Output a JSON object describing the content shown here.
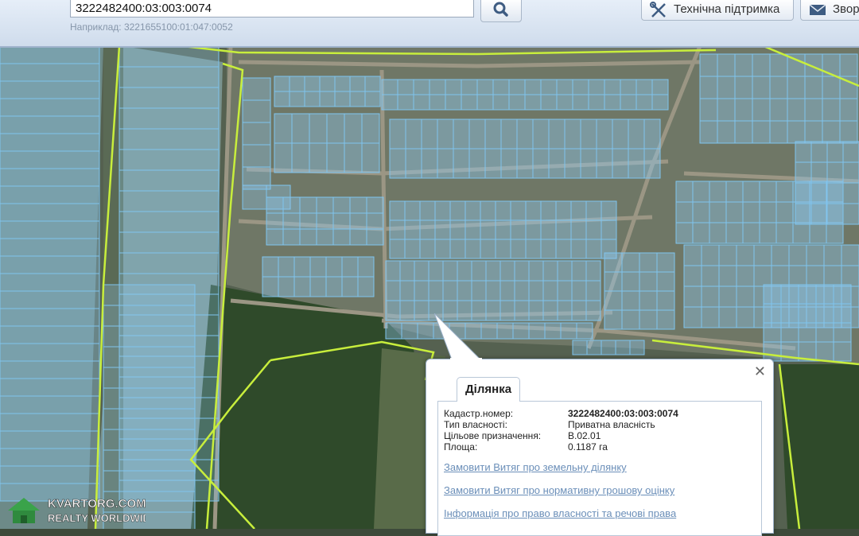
{
  "search": {
    "value": "3222482400:03:003:0074",
    "hint": "Наприклад: 3221655100:01:047:0052"
  },
  "toolbar": {
    "support_label": "Технічна підтримка",
    "feedback_label": "Звор"
  },
  "popup": {
    "tab_label": "Ділянка",
    "fields": [
      {
        "label": "Кадастр.номер:",
        "value": "3222482400:03:003:0074"
      },
      {
        "label": "Тип власності:",
        "value": "Приватна власність"
      },
      {
        "label": "Цільове призначення:",
        "value": "В.02.01"
      },
      {
        "label": "Площа:",
        "value": "0.1187 га"
      }
    ],
    "links": [
      "Замовити Витяг про земельну ділянку",
      "Замовити Витяг про нормативну грошову оцінку",
      "Інформація про право власності та речові права"
    ]
  },
  "watermark": {
    "brand": "KVARTORG.COM",
    "tagline": "REALTY WORLDWIDE"
  },
  "colors": {
    "parcel_outline": "#7fc4ee",
    "parcel_fill": "#8ec9ee",
    "boundary": "#c8ee3c",
    "link": "#6b8fb9"
  }
}
